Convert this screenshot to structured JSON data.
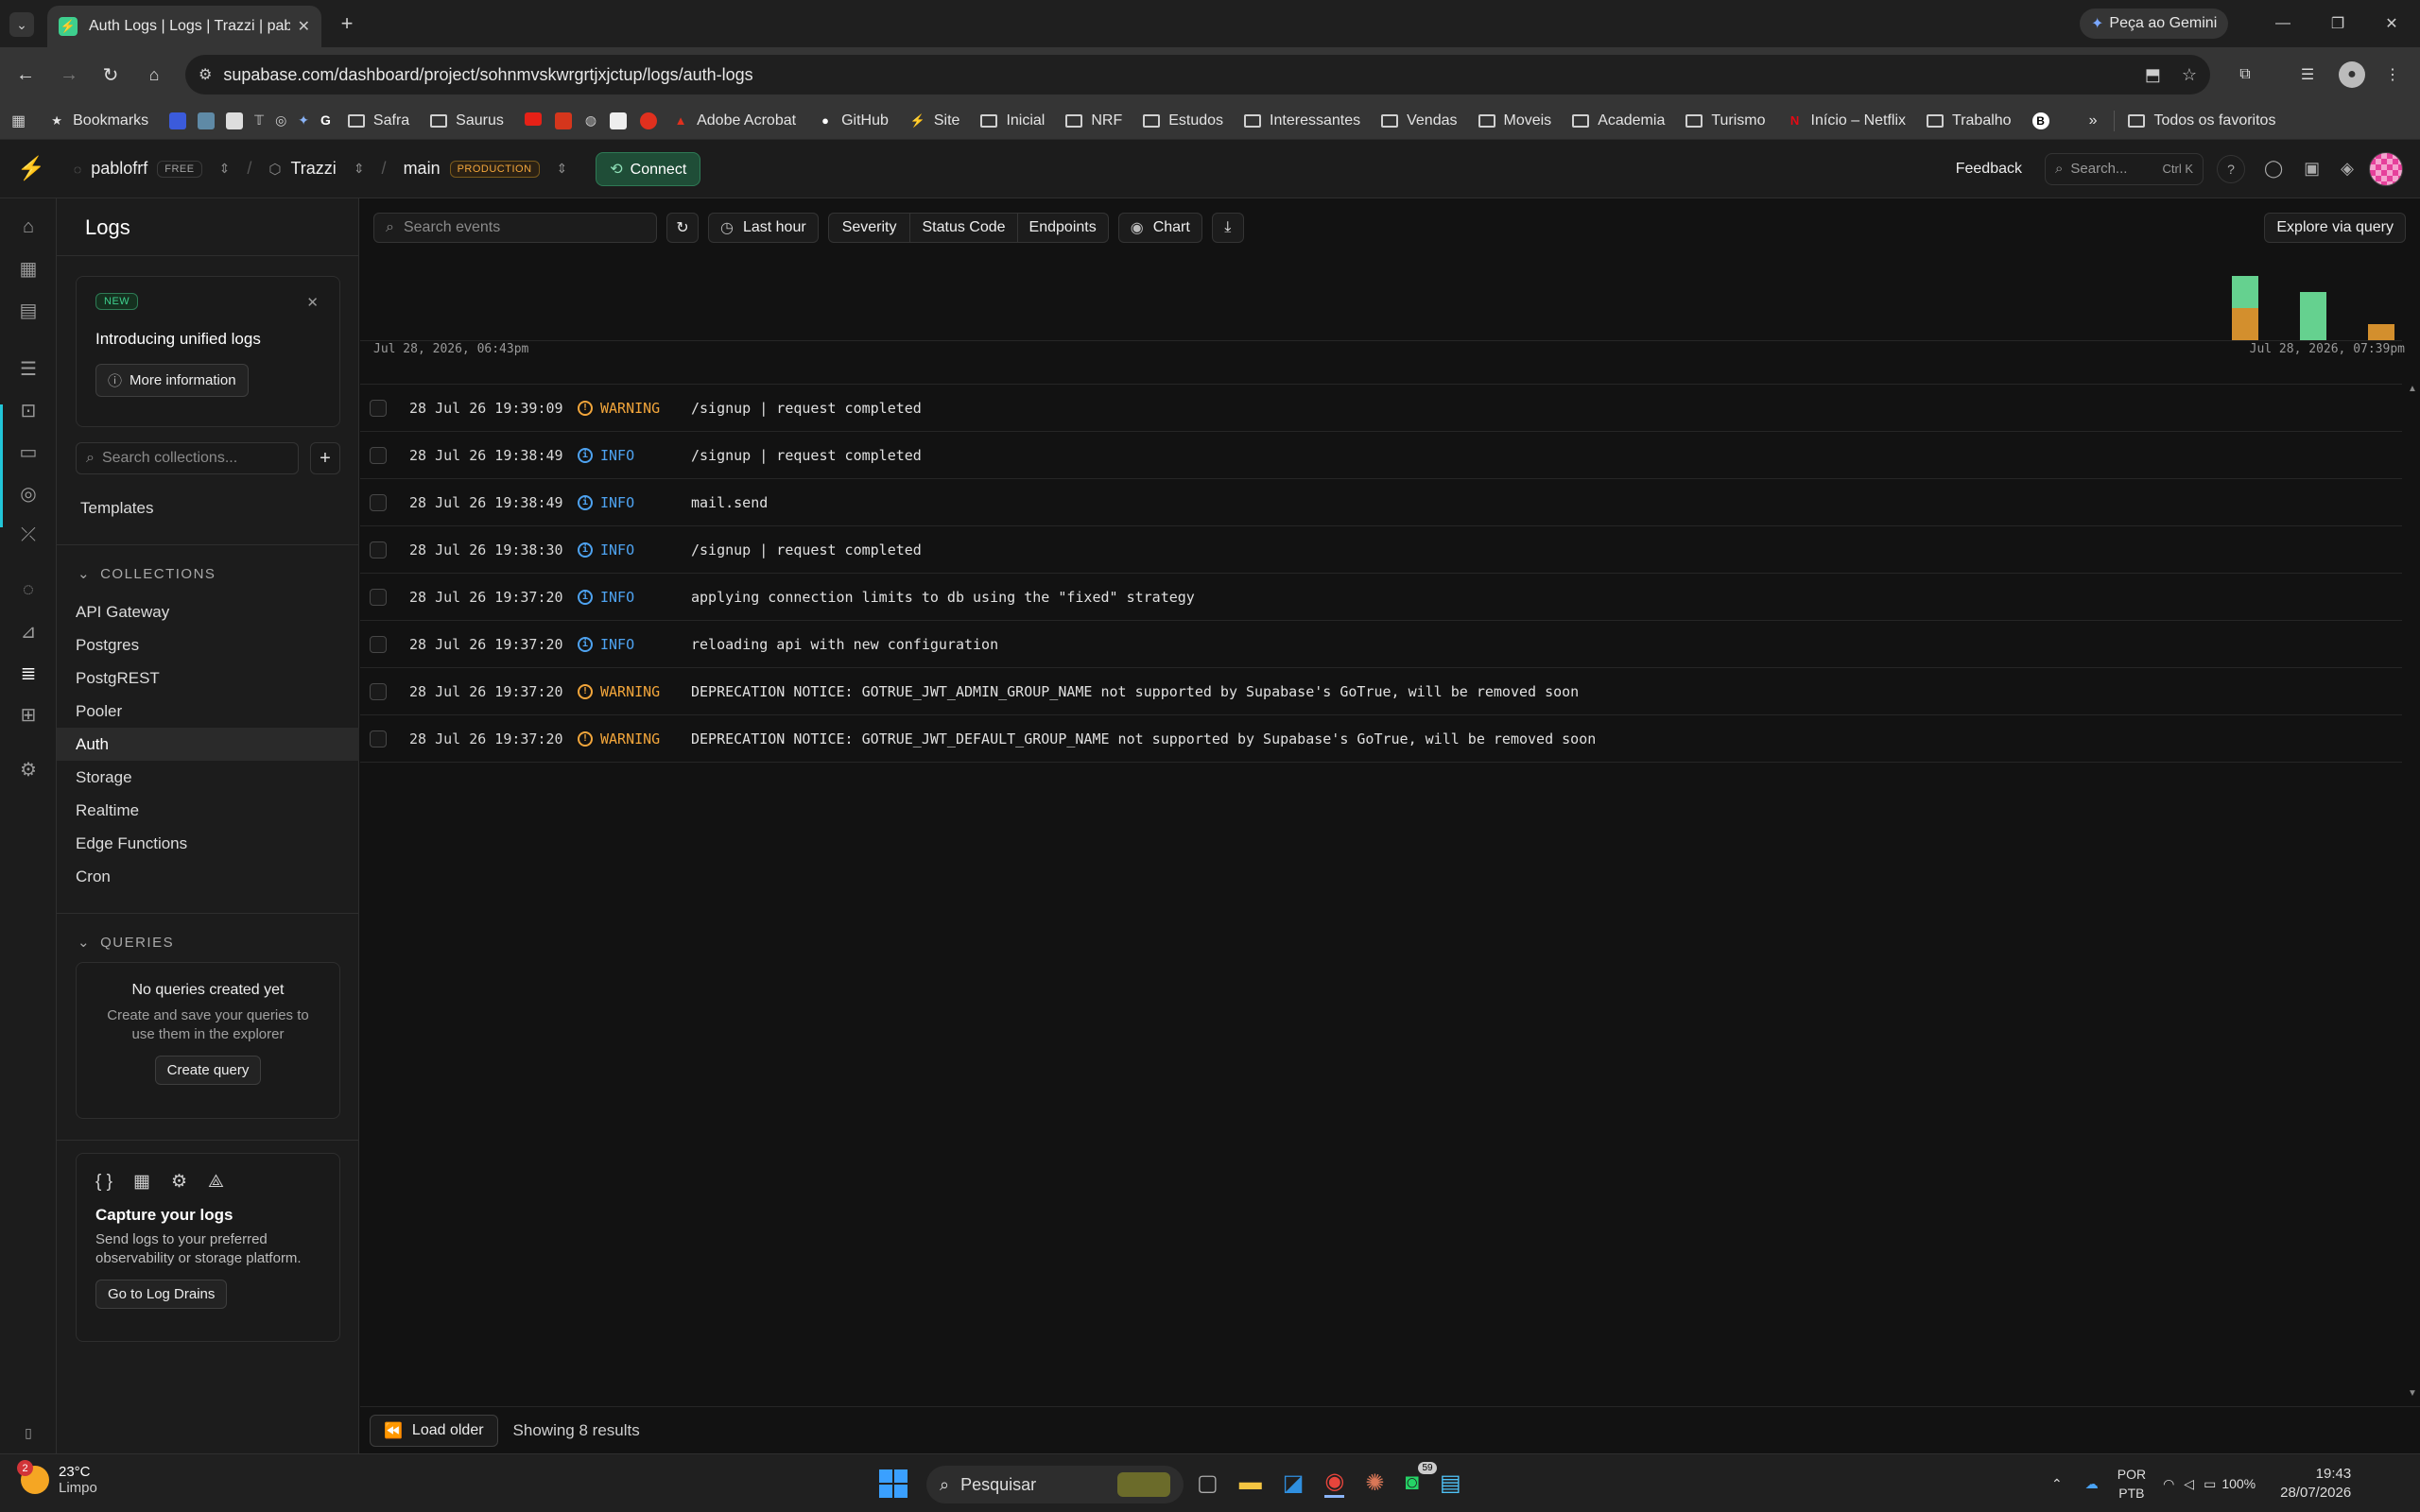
{
  "browser": {
    "tab_title": "Auth Logs | Logs | Trazzi | pablo",
    "url": "supabase.com/dashboard/project/sohnmvskwrgrtjxjctup/logs/auth-logs",
    "gemini": "Peça ao Gemini",
    "bookmarks": [
      "Bookmarks",
      "Safra",
      "Saurus",
      "Adobe Acrobat",
      "GitHub",
      "Site",
      "Inicial",
      "NRF",
      "Estudos",
      "Interessantes",
      "Vendas",
      "Moveis",
      "Academia",
      "Turismo",
      "Início – Netflix",
      "Trabalho"
    ],
    "all_bookmarks": "Todos os favoritos"
  },
  "header": {
    "org": "pablofrf",
    "org_plan": "FREE",
    "project": "Trazzi",
    "branch": "main",
    "branch_env": "PRODUCTION",
    "connect": "Connect",
    "feedback": "Feedback",
    "search": "Search...",
    "shortcut": "Ctrl K"
  },
  "sidebar": {
    "title": "Logs",
    "promo": {
      "badge": "NEW",
      "title": "Introducing unified logs",
      "button": "More information"
    },
    "search_placeholder": "Search collections...",
    "templates": "Templates",
    "collections_header": "COLLECTIONS",
    "collections": [
      "API Gateway",
      "Postgres",
      "PostgREST",
      "Pooler",
      "Auth",
      "Storage",
      "Realtime",
      "Edge Functions",
      "Cron"
    ],
    "active_collection": "Auth",
    "queries_header": "QUERIES",
    "queries_empty_title": "No queries created yet",
    "queries_empty_text": "Create and save your queries to use them in the explorer",
    "create_query": "Create query",
    "capture": {
      "icons": [
        "{ }",
        "▦",
        "⚙",
        "⟁"
      ],
      "title": "Capture your logs",
      "text": "Send logs to your preferred observability or storage platform.",
      "button": "Go to Log Drains"
    }
  },
  "filters": {
    "search_placeholder": "Search events",
    "range": "Last hour",
    "severity": "Severity",
    "status_code": "Status Code",
    "endpoints": "Endpoints",
    "chart": "Chart",
    "explore": "Explore via query"
  },
  "chart_data": {
    "type": "bar",
    "x_start_label": "Jul 28, 2026, 06:43pm",
    "x_end_label": "Jul 28, 2026, 07:39pm",
    "colors": {
      "info": "#65d18f",
      "warning": "#d38f2d"
    },
    "bars": [
      {
        "info": 2,
        "warning": 2
      },
      {
        "info": 3,
        "warning": 0
      },
      {
        "info": 0,
        "warning": 1
      }
    ]
  },
  "logs": [
    {
      "ts": "28 Jul 26 19:39:09",
      "level": "WARNING",
      "msg": "/signup | request completed"
    },
    {
      "ts": "28 Jul 26 19:38:49",
      "level": "INFO",
      "msg": "/signup | request completed"
    },
    {
      "ts": "28 Jul 26 19:38:49",
      "level": "INFO",
      "msg": "mail.send"
    },
    {
      "ts": "28 Jul 26 19:38:30",
      "level": "INFO",
      "msg": "/signup | request completed"
    },
    {
      "ts": "28 Jul 26 19:37:20",
      "level": "INFO",
      "msg": "applying connection limits to db using the \"fixed\" strategy"
    },
    {
      "ts": "28 Jul 26 19:37:20",
      "level": "INFO",
      "msg": "reloading api with new configuration"
    },
    {
      "ts": "28 Jul 26 19:37:20",
      "level": "WARNING",
      "msg": "DEPRECATION NOTICE: GOTRUE_JWT_ADMIN_GROUP_NAME not supported by Supabase's GoTrue, will be removed soon"
    },
    {
      "ts": "28 Jul 26 19:37:20",
      "level": "WARNING",
      "msg": "DEPRECATION NOTICE: GOTRUE_JWT_DEFAULT_GROUP_NAME not supported by Supabase's GoTrue, will be removed soon"
    }
  ],
  "footer": {
    "load_older": "Load older",
    "results": "Showing 8 results"
  },
  "taskbar": {
    "temp": "23°C",
    "weather": "Limpo",
    "weather_badge": "2",
    "search": "Pesquisar",
    "whatsapp_badge": "59",
    "lang1": "POR",
    "lang2": "PTB",
    "battery": "100%",
    "time": "19:43",
    "date": "28/07/2026"
  }
}
